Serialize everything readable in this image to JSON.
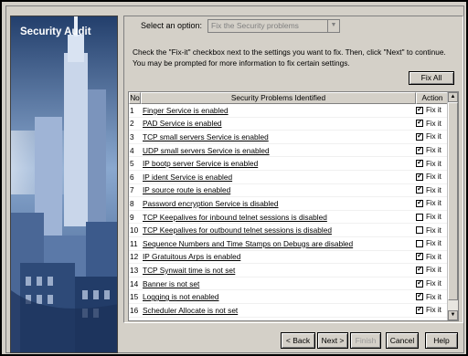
{
  "banner": {
    "title": "Security Audit"
  },
  "option": {
    "label": "Select an option:",
    "value": "Fix the Security problems"
  },
  "instructions": {
    "line1": "Check the \"Fix-it\" checkbox next to the settings you want to fix. Then, click \"Next\" to continue.",
    "line2": "You may be prompted for more information to fix certain settings."
  },
  "fix_all": "Fix All",
  "table": {
    "headers": {
      "no": "No",
      "problem": "Security Problems Identified",
      "action": "Action"
    },
    "rows": [
      {
        "no": "1",
        "problem": "Finger Service is enabled",
        "checked": true,
        "action": "Fix it"
      },
      {
        "no": "2",
        "problem": "PAD Service is enabled",
        "checked": true,
        "action": "Fix it"
      },
      {
        "no": "3",
        "problem": "TCP small servers Service is enabled",
        "checked": true,
        "action": "Fix it"
      },
      {
        "no": "4",
        "problem": "UDP small servers Service is enabled",
        "checked": true,
        "action": "Fix it"
      },
      {
        "no": "5",
        "problem": "IP bootp server Service is enabled",
        "checked": true,
        "action": "Fix it"
      },
      {
        "no": "6",
        "problem": "IP ident Service is enabled",
        "checked": true,
        "action": "Fix it"
      },
      {
        "no": "7",
        "problem": "IP source route is enabled",
        "checked": true,
        "action": "Fix it"
      },
      {
        "no": "8",
        "problem": "Password encryption Service is disabled",
        "checked": true,
        "action": "Fix it"
      },
      {
        "no": "9",
        "problem": "TCP Keepalives for inbound telnet sessions is disabled",
        "checked": false,
        "action": "Fix it"
      },
      {
        "no": "10",
        "problem": "TCP Keepalives for outbound telnet sessions is disabled",
        "checked": false,
        "action": "Fix it"
      },
      {
        "no": "11",
        "problem": "Sequence Numbers and Time Stamps on Debugs are disabled",
        "checked": false,
        "action": "Fix it"
      },
      {
        "no": "12",
        "problem": "IP Gratuitous Arps is enabled",
        "checked": true,
        "action": "Fix it"
      },
      {
        "no": "13",
        "problem": "TCP Synwait time is not set",
        "checked": true,
        "action": "Fix it"
      },
      {
        "no": "14",
        "problem": "Banner is not set",
        "checked": true,
        "action": "Fix it"
      },
      {
        "no": "15",
        "problem": "Logging is not enabled",
        "checked": true,
        "action": "Fix it"
      },
      {
        "no": "16",
        "problem": "Scheduler Allocate is not set",
        "checked": true,
        "action": "Fix it"
      }
    ]
  },
  "buttons": {
    "back": "< Back",
    "next": "Next >",
    "finish": "Finish",
    "cancel": "Cancel",
    "help": "Help"
  }
}
